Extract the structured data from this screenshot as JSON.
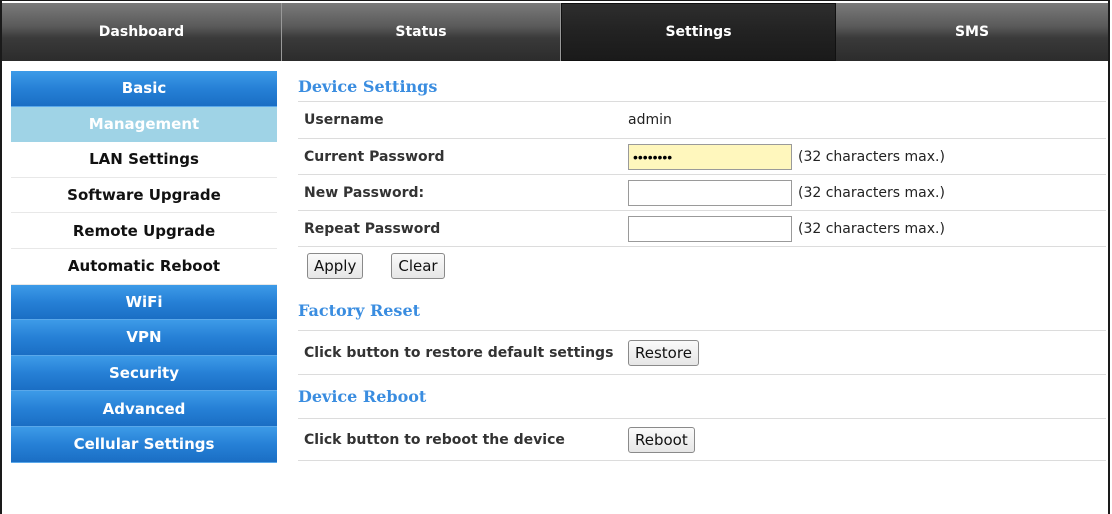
{
  "nav": {
    "tabs": [
      {
        "label": "Dashboard"
      },
      {
        "label": "Status"
      },
      {
        "label": "Settings"
      },
      {
        "label": "SMS"
      }
    ],
    "active_tab": "Settings"
  },
  "sidebar": {
    "items": [
      {
        "label": "Basic"
      },
      {
        "label": "Management"
      },
      {
        "label": "LAN Settings"
      },
      {
        "label": "Software Upgrade"
      },
      {
        "label": "Remote Upgrade"
      },
      {
        "label": "Automatic Reboot"
      },
      {
        "label": "WiFi"
      },
      {
        "label": "VPN"
      },
      {
        "label": "Security"
      },
      {
        "label": "Advanced"
      },
      {
        "label": "Cellular Settings"
      }
    ]
  },
  "device_settings": {
    "title": "Device Settings",
    "username_label": "Username",
    "username_value": "admin",
    "current_password_label": "Current Password",
    "current_password_value": "xxxxxxxx",
    "new_password_label": "New Password:",
    "repeat_password_label": "Repeat Password",
    "hint": "(32 characters max.)",
    "apply_label": "Apply",
    "clear_label": "Clear"
  },
  "factory_reset": {
    "title": "Factory Reset",
    "text": "Click button to restore default settings",
    "button_label": "Restore"
  },
  "device_reboot": {
    "title": "Device Reboot",
    "text": "Click button to reboot the device",
    "button_label": "Reboot"
  },
  "colors": {
    "accent": "#3a8de0",
    "sidebar_blue": "#2680d6",
    "sidebar_current": "#9fd3e6",
    "password_fill": "#fff7bd"
  }
}
